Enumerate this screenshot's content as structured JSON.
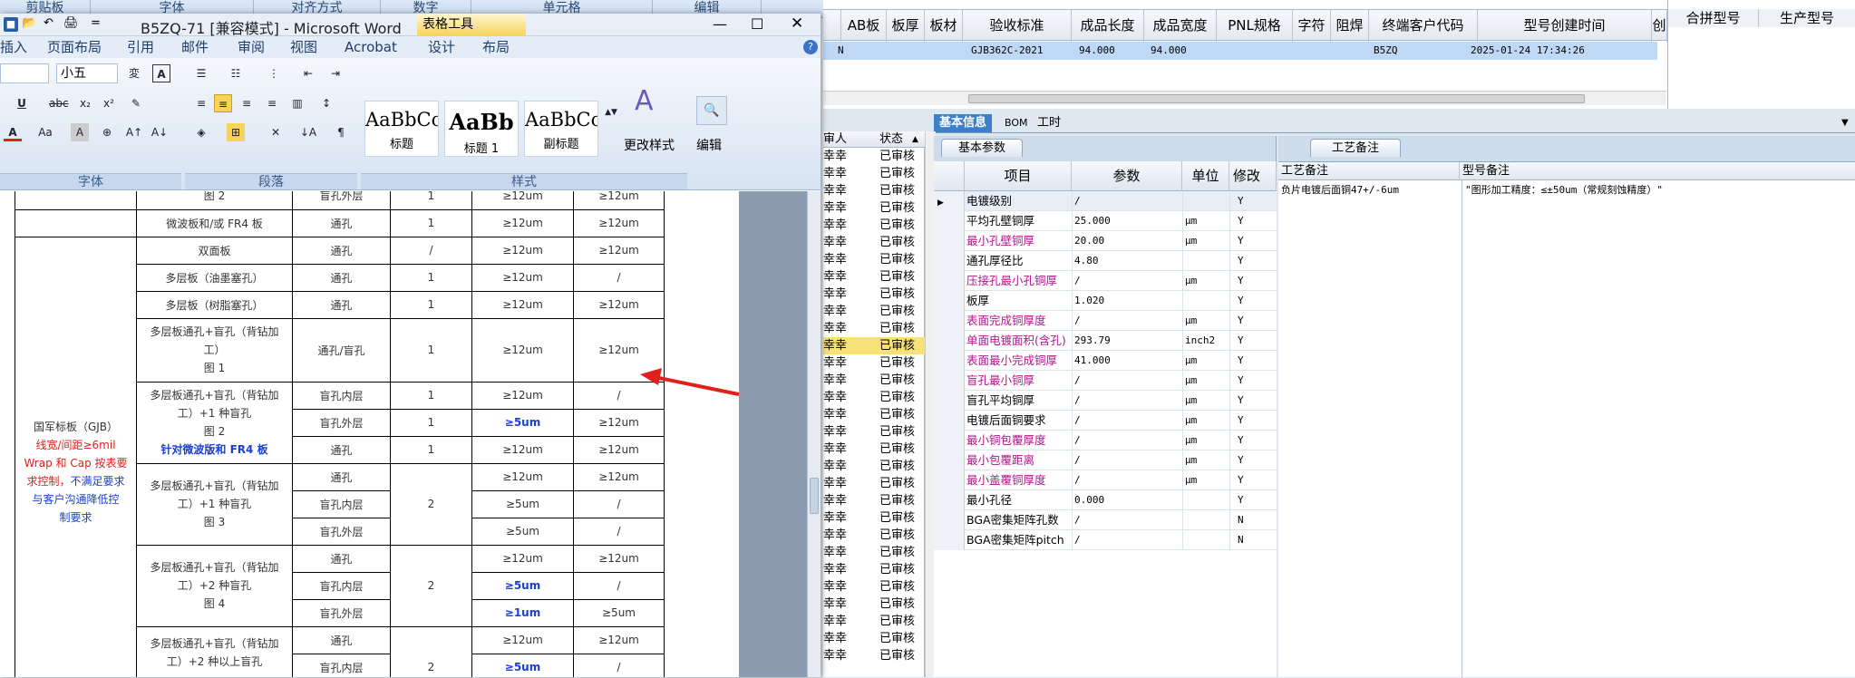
{
  "excel_strip": {
    "groups": [
      "剪贴板",
      "字体",
      "对齐方式",
      "数字",
      "单元格",
      "编辑"
    ]
  },
  "word": {
    "title": "B5ZQ-71 [兼容模式] - Microsoft Word",
    "table_tools": "表格工具",
    "tabs": [
      "插入",
      "页面布局",
      "引用",
      "邮件",
      "审阅",
      "视图",
      "Acrobat",
      "设计",
      "布局"
    ],
    "font_size": "小五",
    "groups": {
      "font": "字体",
      "paragraph": "段落",
      "styles": "样式"
    },
    "styles": [
      {
        "preview": "AaBbCc",
        "label": "标题"
      },
      {
        "preview": "AaBb",
        "label": "标题 1"
      },
      {
        "preview": "AaBbCc",
        "label": "副标题"
      }
    ],
    "change_styles": "更改样式",
    "edit": "编辑",
    "table": {
      "r0": {
        "a": "图 2",
        "b": "盲孔外层",
        "c": "1",
        "d": "≥12um",
        "e": "≥12um"
      },
      "r1": {
        "a": "微波板和/或 FR4 板",
        "b": "通孔",
        "c": "1",
        "d": "≥12um",
        "e": "≥12um"
      },
      "r2": {
        "a": "双面板",
        "b": "通孔",
        "c": "/",
        "d": "≥12um",
        "e": "≥12um"
      },
      "r3": {
        "a": "多层板（油墨塞孔）",
        "b": "通孔",
        "c": "1",
        "d": "≥12um",
        "e": "/"
      },
      "r4": {
        "a": "多层板（树脂塞孔）",
        "b": "通孔",
        "c": "1",
        "d": "≥12um",
        "e": "≥12um"
      },
      "r5": {
        "a1": "多层板通孔+盲孔（背钻加",
        "a2": "工）",
        "a3": "图 1",
        "b": "通孔/盲孔",
        "c": "1",
        "d": "≥12um",
        "e": "≥12um"
      },
      "g6": {
        "a1": "多层板通孔+盲孔（背钻加",
        "a2": "工）+1 种盲孔",
        "a3": "图 2",
        "a4": "针对微波版和 FR4 板"
      },
      "r6": {
        "b": "盲孔内层",
        "c": "1",
        "d": "≥12um",
        "e": "/"
      },
      "r7": {
        "b": "盲孔外层",
        "c": "1",
        "d": "≥5um",
        "e": "≥12um"
      },
      "r8": {
        "b": "通孔",
        "c": "1",
        "d": "≥12um",
        "e": "≥12um"
      },
      "g9": {
        "a1": "多层板通孔+盲孔（背钻加",
        "a2": "工）+1 种盲孔",
        "a3": "图 3",
        "c": "2"
      },
      "r9": {
        "b": "通孔",
        "d": "≥12um",
        "e": "≥12um"
      },
      "r10": {
        "b": "盲孔内层",
        "d": "≥5um",
        "e": "/"
      },
      "r11": {
        "b": "盲孔外层",
        "d": "≥5um",
        "e": "/"
      },
      "g12": {
        "a1": "多层板通孔+盲孔（背钻加",
        "a2": "工）+2 种盲孔",
        "a3": "图 4",
        "c": "2"
      },
      "r12": {
        "b": "通孔",
        "d": "≥12um",
        "e": "≥12um"
      },
      "r13": {
        "b": "盲孔内层",
        "d": "≥5um",
        "e": "/"
      },
      "r14": {
        "b": "盲孔外层",
        "d": "≥1um",
        "e": "≥5um"
      },
      "g15": {
        "a1": "多层板通孔+盲孔（背钻加",
        "a2": "工）+2 种以上盲孔",
        "c": "2"
      },
      "r15": {
        "b": "通孔",
        "d": "≥12um",
        "e": "≥12um"
      },
      "r16": {
        "b": "盲孔内层",
        "d": "≥5um",
        "e": "/"
      },
      "side": {
        "l1": "国军标板（GJB）",
        "l2": "线宽/间距≥6mil",
        "l3": "Wrap 和 Cap 按表要",
        "l4": "求控制，",
        "l4b": "不满足要求",
        "l5": "与客户沟通降低控",
        "l6": "制要求"
      }
    }
  },
  "erp": {
    "columns": [
      "AB板",
      "板厚",
      "板材",
      "验收标准",
      "成品长度",
      "成品宽度",
      "PNL规格",
      "字符",
      "阻焊",
      "终端客户代码",
      "型号创建时间",
      "创",
      "合拼型号",
      "生产型号"
    ],
    "row": {
      "ab": "N",
      "standard": "GJB362C-2021",
      "length": "94.000",
      "width": "94.000",
      "customer": "B5ZQ",
      "created": "2025-01-24 17:34:26"
    },
    "list_headers": [
      "审人",
      "状态"
    ],
    "list_user": "幸幸",
    "list_status": "已审核",
    "tabs": [
      "基本信息",
      "BOM",
      "工时"
    ],
    "basic_tab": "基本参数",
    "param_headers": [
      "项目",
      "参数",
      "单位",
      "修改"
    ],
    "params": [
      {
        "name": "电镀级别",
        "val": "/",
        "unit": "",
        "mod": "Y",
        "color": "#000000"
      },
      {
        "name": "平均孔壁铜厚",
        "val": "25.000",
        "unit": "μm",
        "mod": "Y",
        "color": "#000000"
      },
      {
        "name": "最小孔壁铜厚",
        "val": "20.00",
        "unit": "μm",
        "mod": "Y",
        "color": "#b0158a"
      },
      {
        "name": "通孔厚径比",
        "val": "4.80",
        "unit": "",
        "mod": "Y",
        "color": "#000000"
      },
      {
        "name": "压接孔最小孔铜厚",
        "val": "/",
        "unit": "μm",
        "mod": "Y",
        "color": "#b0158a"
      },
      {
        "name": "板厚",
        "val": "1.020",
        "unit": "",
        "mod": "Y",
        "color": "#000000"
      },
      {
        "name": "表面完成铜厚度",
        "val": "/",
        "unit": "μm",
        "mod": "Y",
        "color": "#b0158a"
      },
      {
        "name": "单面电镀面积(含孔)",
        "val": "293.79",
        "unit": "inch2",
        "mod": "Y",
        "color": "#b0158a"
      },
      {
        "name": "表面最小完成铜厚",
        "val": "41.000",
        "unit": "μm",
        "mod": "Y",
        "color": "#b0158a"
      },
      {
        "name": "盲孔最小铜厚",
        "val": "/",
        "unit": "μm",
        "mod": "Y",
        "color": "#b0158a"
      },
      {
        "name": "盲孔平均铜厚",
        "val": "/",
        "unit": "μm",
        "mod": "Y",
        "color": "#000000"
      },
      {
        "name": "电镀后面铜要求",
        "val": "/",
        "unit": "μm",
        "mod": "Y",
        "color": "#000000"
      },
      {
        "name": "最小铜包覆厚度",
        "val": "/",
        "unit": "μm",
        "mod": "Y",
        "color": "#b0158a"
      },
      {
        "name": "最小包覆距离",
        "val": "/",
        "unit": "μm",
        "mod": "Y",
        "color": "#b0158a"
      },
      {
        "name": "最小盖覆铜厚度",
        "val": "/",
        "unit": "μm",
        "mod": "Y",
        "color": "#b0158a"
      },
      {
        "name": "最小孔径",
        "val": "0.000",
        "unit": "",
        "mod": "Y",
        "color": "#000000"
      },
      {
        "name": "BGA密集矩阵孔数",
        "val": "/",
        "unit": "",
        "mod": "N",
        "color": "#000000"
      },
      {
        "name": "BGA密集矩阵pitch",
        "val": "/",
        "unit": "",
        "mod": "N",
        "color": "#000000"
      }
    ],
    "remarks_tab": "工艺备注",
    "remarks_headers": [
      "工艺备注",
      "型号备注"
    ],
    "remark_left": "负片电镀后面铜47+/-6um",
    "remark_right": "\"图形加工精度：≤±50um（常规刻蚀精度）\""
  }
}
